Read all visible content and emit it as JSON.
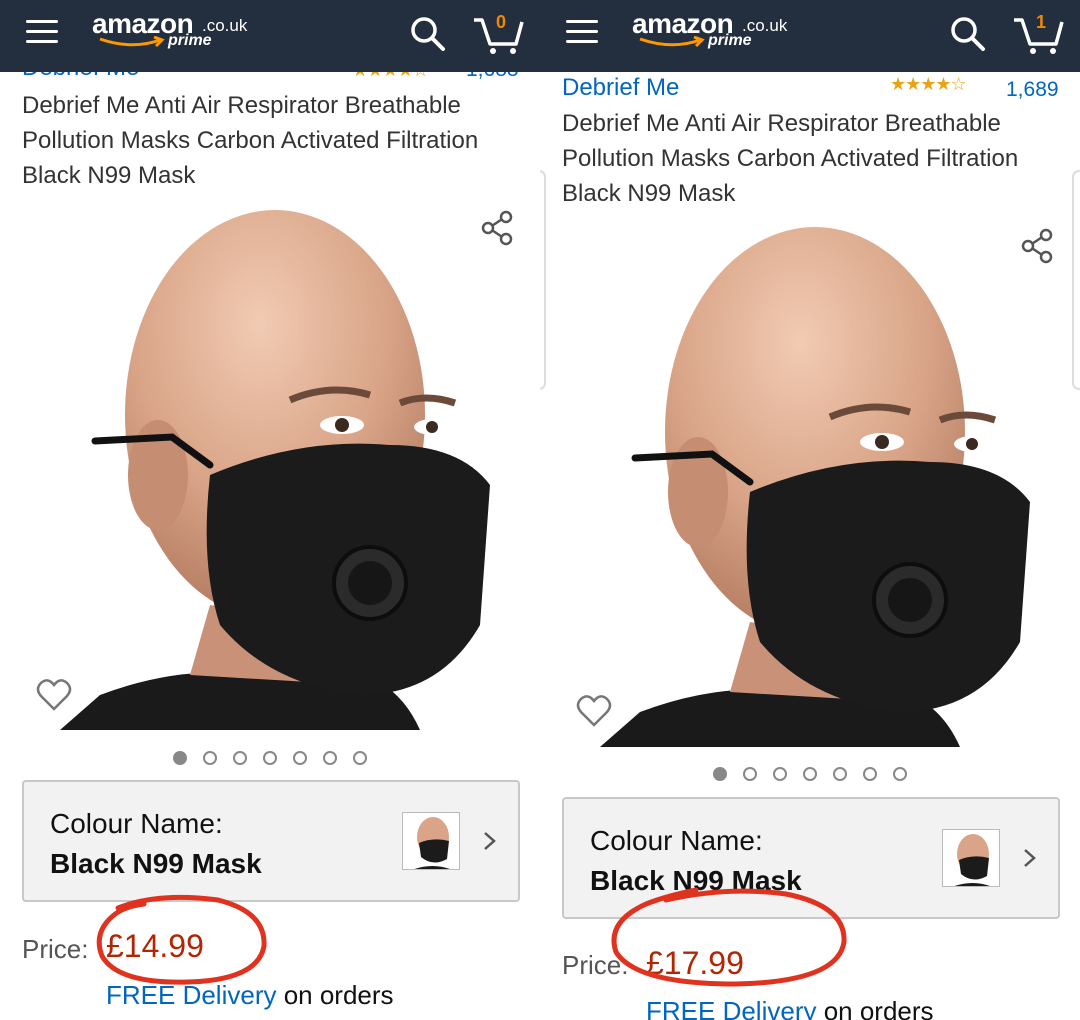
{
  "left": {
    "header": {
      "logo_word": "amazon",
      "logo_tld": ".co.uk",
      "logo_prime": "prime",
      "cart_count": "0"
    },
    "brand": "Debrief Me",
    "rating_count": "1,688",
    "title": "Debrief Me Anti Air Respirator Breathable Pollution Masks Carbon Activated Filtration Black N99 Mask",
    "colour_label": "Colour Name:",
    "colour_value": "Black N99 Mask",
    "price_label": "Price:",
    "price_value": "£14.99",
    "delivery_link": "FREE Delivery",
    "delivery_rest": " on orders",
    "image_count": 7,
    "active_image": 1
  },
  "right": {
    "header": {
      "logo_word": "amazon",
      "logo_tld": ".co.uk",
      "logo_prime": "prime",
      "cart_count": "1"
    },
    "brand": "Debrief Me",
    "rating_count": "1,689",
    "rating_stars": 4.5,
    "title": "Debrief Me Anti Air Respirator Breathable Pollution Masks Carbon Activated Filtration Black N99 Mask",
    "colour_label": "Colour Name:",
    "colour_value": "Black N99 Mask",
    "price_label": "Price:",
    "price_value": "£17.99",
    "delivery_link": "FREE Delivery",
    "delivery_rest": " on orders",
    "image_count": 7,
    "active_image": 1
  },
  "colors": {
    "header_bg": "#232f3e",
    "link": "#0066c0",
    "price": "#b12704",
    "annotation_circle": "#e0331f",
    "stars": "#e7a415",
    "cart_count": "#f08804"
  },
  "icons": [
    "hamburger-icon",
    "search-icon",
    "cart-icon",
    "share-icon",
    "heart-icon",
    "chevron-right-icon"
  ]
}
